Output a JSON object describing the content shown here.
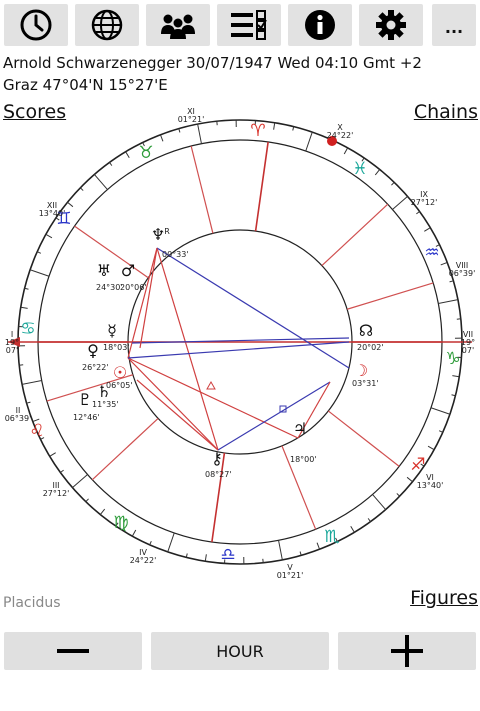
{
  "toolbar": {
    "buttons": [
      {
        "icon": "clock-icon"
      },
      {
        "icon": "globe-icon"
      },
      {
        "icon": "people-icon"
      },
      {
        "icon": "checklist-icon"
      },
      {
        "icon": "info-icon"
      },
      {
        "icon": "gear-icon"
      },
      {
        "icon": "more-icon",
        "label": "..."
      }
    ]
  },
  "header": {
    "line1": "Arnold Schwarzenegger 30/07/1947 Wed 04:10 Gmt +2",
    "line2": "Graz 47°04'N 15°27'E"
  },
  "links": {
    "scores": "Scores",
    "chains": "Chains",
    "figures": "Figures"
  },
  "house_system": "Placidus",
  "bottom": {
    "minus": "minus-icon",
    "hour": "HOUR",
    "plus": "plus-icon"
  },
  "houses": [
    {
      "name": "I",
      "deg": "19°",
      "min": "07'"
    },
    {
      "name": "II",
      "deg": "06°39'"
    },
    {
      "name": "III",
      "deg": "27°12'"
    },
    {
      "name": "IV",
      "deg": "24°22'"
    },
    {
      "name": "V",
      "deg": "01°21'"
    },
    {
      "name": "VI",
      "deg": "13°40'"
    },
    {
      "name": "VII",
      "deg": "19°",
      "min": "07'"
    },
    {
      "name": "VIII",
      "deg": "06°39'"
    },
    {
      "name": "IX",
      "deg": "27°12'"
    },
    {
      "name": "X",
      "deg": "24°22'"
    },
    {
      "name": "XI",
      "deg": "01°21'"
    },
    {
      "name": "XII",
      "deg": "13°40'"
    }
  ],
  "planets": [
    {
      "name": "neptune",
      "glyph": "♆",
      "pos": "00°33'",
      "retro": "R"
    },
    {
      "name": "uranus",
      "glyph": "♅",
      "pos": "24°30'"
    },
    {
      "name": "mars",
      "glyph": "♂",
      "pos": "20°06'"
    },
    {
      "name": "mercury",
      "glyph": "☿",
      "pos": "18°03'"
    },
    {
      "name": "venus",
      "glyph": "♀",
      "pos": "26°22'"
    },
    {
      "name": "sun",
      "glyph": "☉",
      "pos": "06°05'"
    },
    {
      "name": "saturn",
      "glyph": "♄",
      "pos": "11°35'"
    },
    {
      "name": "pluto",
      "glyph": "♇",
      "pos": "12°46'"
    },
    {
      "name": "jupiter",
      "glyph": "♃",
      "pos": "18°00'"
    },
    {
      "name": "moon",
      "glyph": "☽",
      "pos": "03°31'"
    },
    {
      "name": "chiron",
      "glyph": "⚷",
      "pos": "08°27'"
    },
    {
      "name": "node",
      "glyph": "☊",
      "pos": "20°02'"
    }
  ],
  "signs": [
    "♈",
    "♉",
    "♊",
    "♋",
    "♌",
    "♍",
    "♎",
    "♏",
    "♐",
    "♑",
    "♒",
    "♓"
  ],
  "colors": {
    "fire": "#d8322a",
    "earth": "#2e9c3a",
    "air": "#2a35c8",
    "water": "#1aa79a",
    "aspect_red": "#d04040",
    "aspect_blue": "#3a3ab0"
  }
}
